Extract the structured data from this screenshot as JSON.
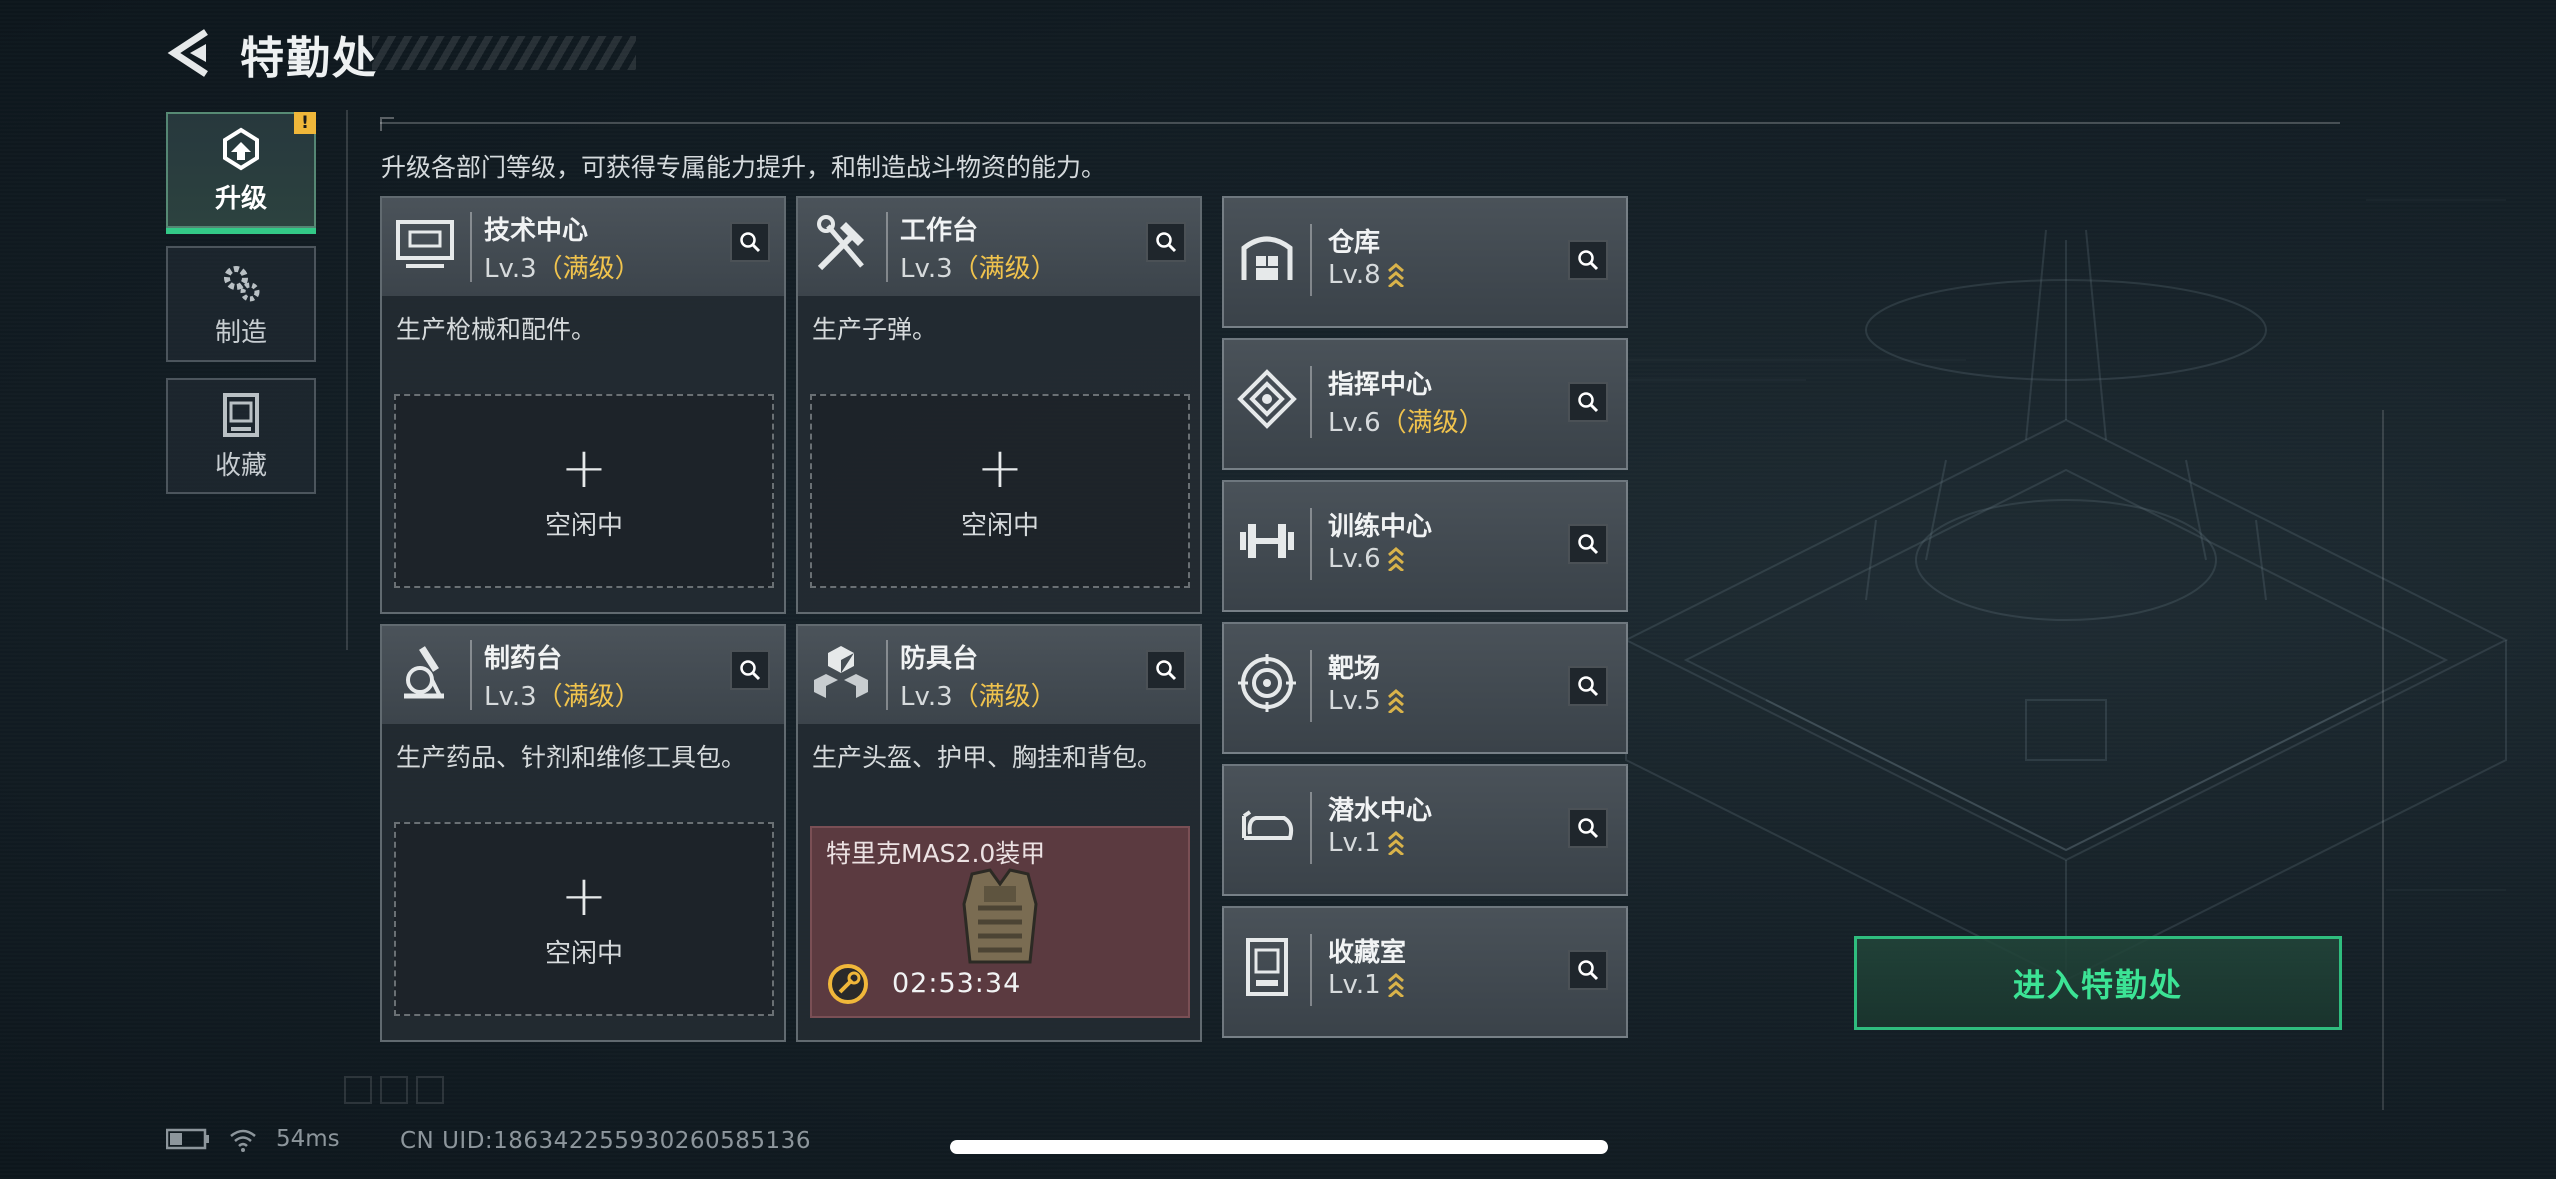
{
  "header": {
    "title": "特勤处"
  },
  "nav": [
    {
      "label": "升级",
      "active": true,
      "alert": "!"
    },
    {
      "label": "制造",
      "active": false
    },
    {
      "label": "收藏",
      "active": false
    }
  ],
  "description": "升级各部门等级，可获得专属能力提升，和制造战斗物资的能力。",
  "workstations": [
    {
      "name": "技术中心",
      "level": "Lv.3",
      "max": "（满级）",
      "desc": "生产枪械和配件。",
      "slot_plus": "+",
      "slot_status": "空闲中",
      "icon": "computer-icon"
    },
    {
      "name": "工作台",
      "level": "Lv.3",
      "max": "（满级）",
      "desc": "生产子弹。",
      "slot_plus": "+",
      "slot_status": "空闲中",
      "icon": "tools-icon"
    },
    {
      "name": "制药台",
      "level": "Lv.3",
      "max": "（满级）",
      "desc": "生产药品、针剂和维修工具包。",
      "slot_plus": "+",
      "slot_status": "空闲中",
      "icon": "microscope-icon"
    },
    {
      "name": "防具台",
      "level": "Lv.3",
      "max": "（满级）",
      "desc": "生产头盔、护甲、胸挂和背包。",
      "crafting": {
        "item": "特里克MAS2.0装甲",
        "timer": "02:53:34"
      },
      "icon": "armor-boxes-icon"
    }
  ],
  "facilities": [
    {
      "name": "仓库",
      "level": "Lv.8",
      "max": "",
      "upgradable": true,
      "icon": "warehouse-icon"
    },
    {
      "name": "指挥中心",
      "level": "Lv.6",
      "max": "（满级）",
      "upgradable": false,
      "icon": "command-icon"
    },
    {
      "name": "训练中心",
      "level": "Lv.6",
      "max": "",
      "upgradable": true,
      "icon": "dumbbell-icon"
    },
    {
      "name": "靶场",
      "level": "Lv.5",
      "max": "",
      "upgradable": true,
      "icon": "target-icon"
    },
    {
      "name": "潜水中心",
      "level": "Lv.1",
      "max": "",
      "upgradable": true,
      "icon": "diving-mask-icon"
    },
    {
      "name": "收藏室",
      "level": "Lv.1",
      "max": "",
      "upgradable": true,
      "icon": "collection-icon"
    }
  ],
  "enter_button": "进入特勤处",
  "status": {
    "ping": "54ms",
    "uid": "CN UID:1863422559302605851​36"
  },
  "colors": {
    "accent": "#33c987",
    "max_level": "#f0c34d",
    "crafting_bg": "#5b3a40"
  }
}
